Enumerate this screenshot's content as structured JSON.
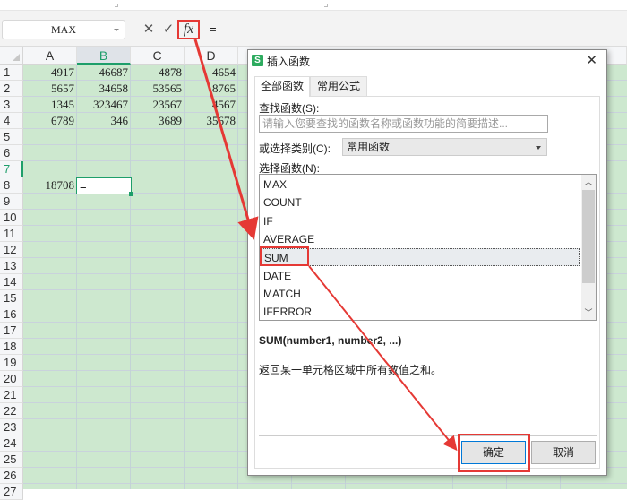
{
  "formula_bar": {
    "name_box": "MAX",
    "cancel_icon": "✕",
    "confirm_icon": "✓",
    "fx_label": "fx",
    "formula": "="
  },
  "sheet": {
    "columns": [
      "A",
      "B",
      "C",
      "D"
    ],
    "selected_column": "B",
    "rows": [
      "1",
      "2",
      "3",
      "4",
      "5",
      "6",
      "7",
      "8",
      "9",
      "10",
      "11",
      "12",
      "13",
      "14",
      "15",
      "16",
      "17",
      "18",
      "19",
      "20",
      "21",
      "22",
      "23",
      "24",
      "25",
      "26",
      "27"
    ],
    "selected_row": "7",
    "data": [
      [
        "4917",
        "46687",
        "4878",
        "4654"
      ],
      [
        "5657",
        "34658",
        "53565",
        "8765"
      ],
      [
        "1345",
        "323467",
        "23567",
        "4567"
      ],
      [
        "6789",
        "346",
        "3689",
        "35678"
      ]
    ],
    "a7": "18708",
    "b7_editing": "="
  },
  "dialog": {
    "logo": "S",
    "title": "插入函数",
    "close_icon": "✕",
    "tabs": [
      "全部函数",
      "常用公式"
    ],
    "search_label": "查找函数(S):",
    "search_placeholder": "请输入您要查找的函数名称或函数功能的简要描述...",
    "category_label": "或选择类别(C):",
    "category_value": "常用函数",
    "function_label": "选择函数(N):",
    "functions": [
      "MAX",
      "COUNT",
      "IF",
      "AVERAGE",
      "SUM",
      "DATE",
      "MATCH",
      "IFERROR"
    ],
    "selected_function": "SUM",
    "signature": "SUM(number1, number2, ...)",
    "description": "返回某一单元格区域中所有数值之和。",
    "ok_label": "确定",
    "cancel_label": "取消"
  },
  "annotation_color": "#e53935"
}
